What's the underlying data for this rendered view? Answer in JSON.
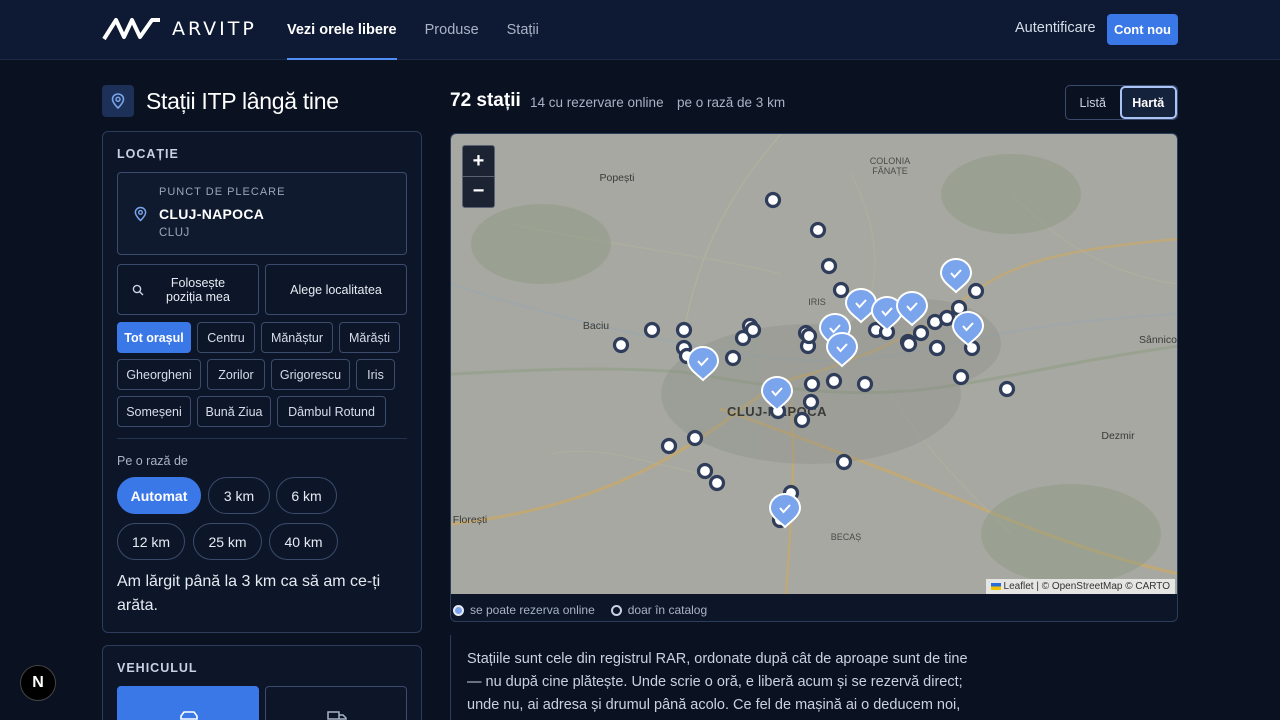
{
  "header": {
    "brand": "ARVITP",
    "nav": [
      "Vezi orele libere",
      "Produse",
      "Stații"
    ],
    "signin": "Autentificare",
    "signup": "Cont nou"
  },
  "sidebar": {
    "title": "Stații ITP lângă tine",
    "location": {
      "heading": "LOCAȚIE",
      "origin_caption": "PUNCT DE PLECARE",
      "origin_city": "CLUJ-NAPOCA",
      "origin_county": "CLUJ",
      "use_position": "Folosește poziția mea",
      "pick_locality": "Alege localitatea",
      "areas": [
        "Tot orașul",
        "Centru",
        "Mănăștur",
        "Mărăști",
        "Gheorgheni",
        "Zorilor",
        "Grigorescu",
        "Iris",
        "Someșeni",
        "Bună Ziua",
        "Dâmbul Rotund"
      ],
      "active_area": "Tot orașul",
      "radius_label": "Pe o rază de",
      "radii": [
        "Automat",
        "3 km",
        "6 km",
        "12 km",
        "25 km",
        "40 km"
      ],
      "active_radius": "Automat",
      "radius_note": "Am lărgit până la 3 km ca să am ce-ți arăta."
    },
    "vehicle": {
      "heading": "VEHICULUL"
    }
  },
  "results": {
    "count": "72 stații",
    "online": "14 cu rezervare online",
    "radius": "pe o rază de 3 km",
    "view_list": "Listă",
    "view_map": "Hartă",
    "active_view": "Hartă"
  },
  "map": {
    "labels": {
      "city": "CLUJ-NAPOCA",
      "popesti": "Popești",
      "colonia_1": "COLONIA",
      "colonia_2": "FĂNAȚE",
      "iris": "IRIS",
      "baciu": "Baciu",
      "sannicoara": "Sânnicoar",
      "dezmir": "Dezmir",
      "floresti": "Florești",
      "becas": "BECAȘ"
    },
    "attribution": "Leaflet | © OpenStreetMap © CARTO",
    "legend_online": "se poate rezerva online",
    "legend_catalog": "doar în catalog"
  },
  "description": "Stațiile sunt cele din registrul RAR, ordonate după cât de aproape sunt de tine — nu după cine plătește. Unde scrie o oră, e liberă acum și se rezervă direct; unde nu, ai adresa și drumul până acolo. Ce fel de mașină ai o deducem noi, iar stațiile",
  "colors": {
    "accent": "#3b78e7",
    "bg": "#0a1120",
    "map": "#a7a8a1"
  }
}
